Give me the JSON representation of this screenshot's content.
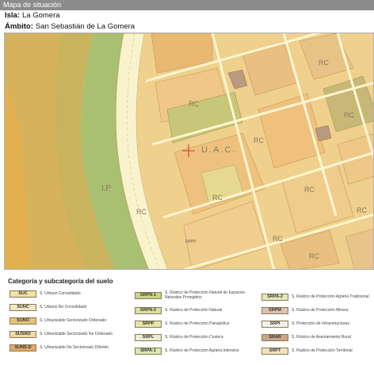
{
  "header": {
    "title": "Mapa de situación",
    "isla_label": "Isla:",
    "isla_value": "La Gomera",
    "ambito_label": "Ámbito:",
    "ambito_value": "San Sebastián de La Gomera"
  },
  "map": {
    "labels": {
      "rc_1": "RC",
      "rc_2": "RC",
      "rc_3": "RC",
      "rc_4": "RC",
      "rc_5": "RC",
      "rc_6": "RC",
      "rc_7": "RC",
      "rc_8": "RC",
      "lp": "LP",
      "rc_9": "RC",
      "rc_10": "RC",
      "uac": "U.A.C.",
      "code_small": "DPPP"
    },
    "colors": {
      "urban": "#f2d79b",
      "urban_dark": "#e8bf79",
      "orange": "#efc786",
      "olive": "#b8c46a",
      "green_band": "#9fbf6f",
      "road": "#f8f1c3",
      "marker": "#d83030"
    }
  },
  "legend": {
    "title": "Categoría y subcategoría del suelo",
    "items": [
      {
        "code": "SUC",
        "label": "S. Urbano Consolidado",
        "color": "#f3e0a6"
      },
      {
        "code": "SUNC",
        "label": "S. Urbano No Consolidado",
        "color": "#f1e8c8"
      },
      {
        "code": "SUNO",
        "label": "S. Urbanizable Sectorizado Ordenado",
        "color": "#e7c17a"
      },
      {
        "code": "SUSNO",
        "label": "S. Urbanizable Sectorizado No Ordenado",
        "color": "#efd9a9"
      },
      {
        "code": "SUNS-D",
        "label": "S. Urbanizable No Sectorizado Diferido",
        "color": "#e0a86a"
      },
      {
        "code": "SRPN-1",
        "label": "S. Rústico de Protección Natural de Espacios Naturales Protegidos",
        "color": "#c8d48a"
      },
      {
        "code": "SRPN-2",
        "label": "S. Rústico de Protección Natural",
        "color": "#d8e0a4"
      },
      {
        "code": "SRPP",
        "label": "S. Rústico de Protección Paisajística",
        "color": "#e6e4a8"
      },
      {
        "code": "SRPL",
        "label": "S. Rústico de Protección Costera",
        "color": "#eaeed2"
      },
      {
        "code": "SRPA-1",
        "label": "S. Rústico de Protección Agraria Intensiva",
        "color": "#d8e8b6"
      },
      {
        "code": "SRPA-2",
        "label": "S. Rústico de Protección Agraria Tradicional",
        "color": "#e4e8bc"
      },
      {
        "code": "SRPM",
        "label": "S. Rústico de Protección Minera",
        "color": "#e0c0b4"
      },
      {
        "code": "SRPI",
        "label": "S. Protección de Infraestructuras",
        "color": "#f2f0ea"
      },
      {
        "code": "SRAR",
        "label": "S. Rústico de Asentamiento Rural",
        "color": "#c9a58c"
      },
      {
        "code": "SRPT",
        "label": "S. Rústico de Protección Territorial",
        "color": "#f0e2c0"
      }
    ]
  }
}
